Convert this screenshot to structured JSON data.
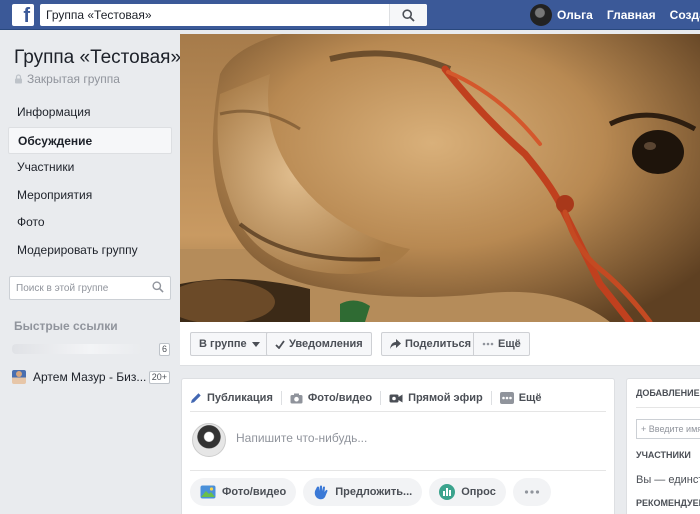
{
  "topbar": {
    "logo_letter": "f",
    "search_value": "Группа «Тестовая»",
    "user_name": "Ольга",
    "home_label": "Главная",
    "create_label": "Создать"
  },
  "group": {
    "title": "Группа «Тестовая»",
    "privacy": "Закрытая группа"
  },
  "sidebar": {
    "items": [
      {
        "label": "Информация",
        "active": false
      },
      {
        "label": "Обсуждение",
        "active": true
      },
      {
        "label": "Участники",
        "active": false
      },
      {
        "label": "Мероприятия",
        "active": false
      },
      {
        "label": "Фото",
        "active": false
      },
      {
        "label": "Модерировать группу",
        "active": false
      }
    ],
    "search_placeholder": "Поиск в этой группе",
    "quick_links_title": "Быстрые ссылки",
    "quick_links": [
      {
        "label": "",
        "badge": "6"
      },
      {
        "label": "Артем Мазур - Биз...",
        "badge": "20+"
      }
    ]
  },
  "action_bar": {
    "in_group": "В группе",
    "notifications": "Уведомления",
    "share": "Поделиться",
    "more": "Ещё"
  },
  "composer": {
    "tabs": [
      "Публикация",
      "Фото/видео",
      "Прямой эфир",
      "Ещё"
    ],
    "placeholder": "Напишите что-нибудь...",
    "pills": [
      "Фото/видео",
      "Предложить...",
      "Опрос"
    ]
  },
  "right_column": {
    "add_members_title": "ДОБАВЛЕНИЕ УЧАСТНИКОВ",
    "add_placeholder": "+ Введите имя или email",
    "members_title": "УЧАСТНИКИ",
    "members_text": "Вы — единственный участник",
    "recommended_title": "РЕКОМЕНДУЕМЫЕ ГРУППЫ"
  },
  "colors": {
    "brand": "#3b5998",
    "page_bg": "#e9ebee",
    "accent": "#4267b2"
  }
}
